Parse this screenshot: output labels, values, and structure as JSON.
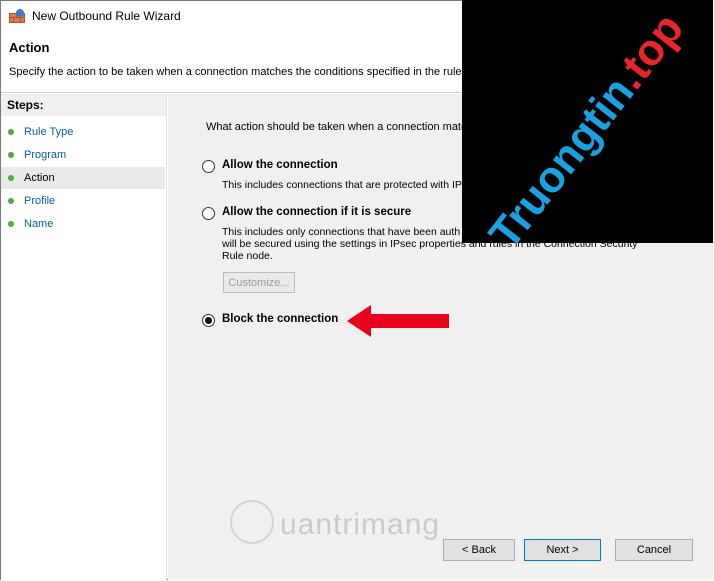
{
  "window": {
    "title": "New Outbound Rule Wizard"
  },
  "header": {
    "title": "Action",
    "description": "Specify the action to be taken when a connection matches the conditions specified in the rule."
  },
  "steps": {
    "title": "Steps:",
    "items": [
      {
        "label": "Rule Type",
        "active": false
      },
      {
        "label": "Program",
        "active": false
      },
      {
        "label": "Action",
        "active": true
      },
      {
        "label": "Profile",
        "active": false
      },
      {
        "label": "Name",
        "active": false
      }
    ]
  },
  "main": {
    "question": "What action should be taken when a connection matc",
    "options": [
      {
        "label": "Allow the connection",
        "description": "This includes connections that are protected with IP",
        "checked": false
      },
      {
        "label": "Allow the connection if it is secure",
        "description_lines": [
          "This includes only connections that have been auth",
          "will be secured using the settings in IPsec properties and rules in the Connection Security",
          "Rule node."
        ],
        "checked": false
      },
      {
        "label": "Block the connection",
        "checked": true
      }
    ],
    "customize_label": "Customize..."
  },
  "buttons": {
    "back": "< Back",
    "next": "Next >",
    "cancel": "Cancel"
  },
  "overlay": {
    "logo": "Truongtin",
    "logo_suffix": ".top",
    "watermark": "uantrimang"
  },
  "colors": {
    "arrow": "#e8001c",
    "logo_blue": "#1aa1e0",
    "accent": "#0078d7"
  }
}
